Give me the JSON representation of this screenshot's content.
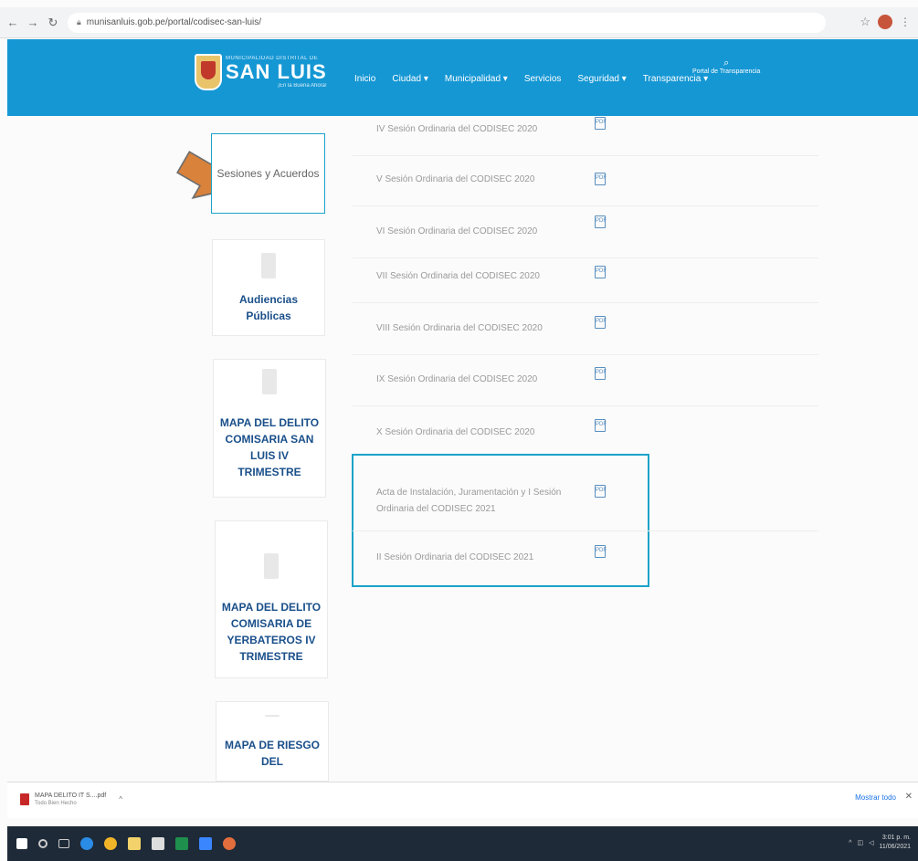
{
  "browser": {
    "url": "munisanluis.gob.pe/portal/codisec-san-luis/"
  },
  "site": {
    "logo_top": "MUNICIPALIDAD DISTRITAL DE",
    "logo_name": "SAN LUIS",
    "logo_sub": "¡En la Buena Ahora!",
    "nav": [
      "Inicio",
      "Ciudad ▾",
      "Municipalidad ▾",
      "Servicios",
      "Seguridad ▾",
      "Transparencia ▾"
    ],
    "search_label": "Portal de Transparencia"
  },
  "sidebar": {
    "cards": [
      {
        "label": "Sesiones y Acuerdos"
      },
      {
        "label": "Audiencias Públicas"
      },
      {
        "label": "MAPA DEL DELITO COMISARIA SAN LUIS IV TRIMESTRE"
      },
      {
        "label": "MAPA DEL DELITO COMISARIA DE YERBATEROS IV TRIMESTRE"
      },
      {
        "label": "MAPA DE RIESGO DEL"
      }
    ]
  },
  "documents": [
    {
      "title": "IV Sesión Ordinaria del CODISEC 2020"
    },
    {
      "title": "V Sesión Ordinaria del CODISEC 2020"
    },
    {
      "title": "VI Sesión Ordinaria del CODISEC 2020"
    },
    {
      "title": "VII Sesión Ordinaria del CODISEC 2020"
    },
    {
      "title": "VIII Sesión Ordinaria del CODISEC 2020"
    },
    {
      "title": "IX Sesión Ordinaria del CODISEC 2020"
    },
    {
      "title": "X Sesión Ordinaria del CODISEC 2020"
    },
    {
      "title": "Acta de Instalación, Juramentación y I Sesión Ordinaria del CODISEC 2021"
    },
    {
      "title": "II Sesión Ordinaria del CODISEC 2021"
    }
  ],
  "download_bar": {
    "file_name": "MAPA DELITO IT S....pdf",
    "file_status": "Todo Bien Hecho",
    "show_all": "Mostrar todo",
    "close": "✕"
  },
  "taskbar": {
    "time": "3:01 p. m.",
    "date": "11/06/2021"
  },
  "icons": {
    "pdf": "pdf-file-icon",
    "arrow": "orange-pointer-arrow"
  },
  "colors": {
    "header": "#1597d4",
    "accent": "#1aa3c9",
    "arrow": "#d9823b",
    "card_text": "#1a4f8a"
  }
}
